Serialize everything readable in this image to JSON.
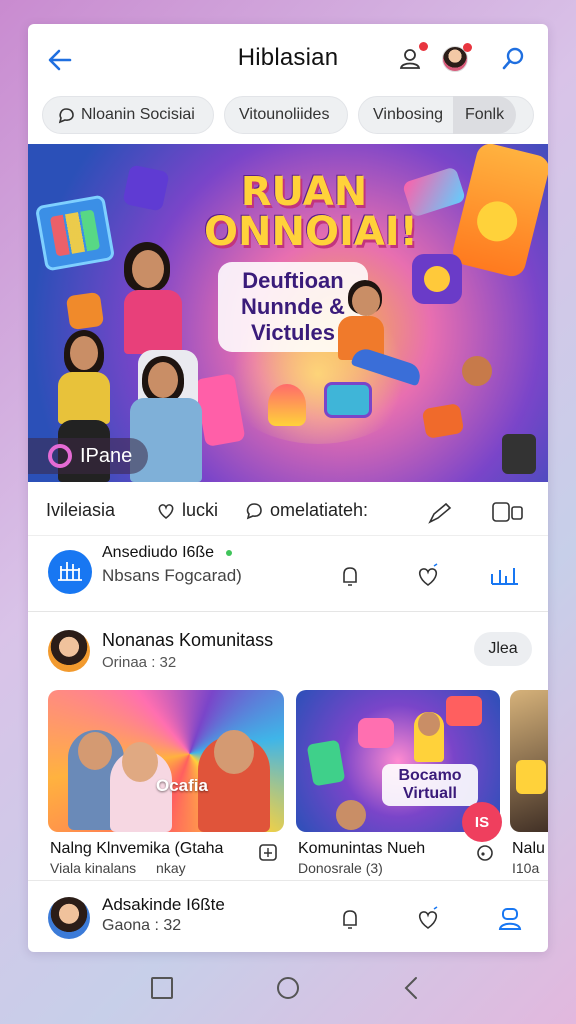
{
  "header": {
    "title": "Hiblasian",
    "back_icon": "arrow-left-icon",
    "icons": [
      "person-notification-icon",
      "profile-avatar",
      "link-icon"
    ]
  },
  "chips": [
    {
      "label": "Nloanin Socisiai",
      "icon": "chat-bubble-icon"
    },
    {
      "label": "Vitounoliides"
    },
    {
      "label": "Vinbosing",
      "segment": "Fonlk"
    }
  ],
  "banner": {
    "headline_1": "RUAN",
    "headline_2": "ONNOIAI!",
    "subtitle": "Deuftioan Nunnde & Victules",
    "live_label": "IPane"
  },
  "actions": {
    "label": "Ivileiasia",
    "like_label": "lucki",
    "comment_label": "omelatiateh:"
  },
  "post": {
    "name": "Ansediudo I6ße",
    "subtitle": "Nbsans Fogcarad)"
  },
  "group": {
    "name": "Nonanas Komunitass",
    "meta": "Orinaa : 32",
    "button": "Jlea"
  },
  "carousel": [
    {
      "title": "Nalng Klnvemika (Gtaha",
      "subtitle": "Viala kinalans",
      "extra": "nkay",
      "image_text": "Ocafia",
      "badge": ""
    },
    {
      "title": "Komunintas Nueh",
      "subtitle": "Donosrale (3)",
      "image_text": "Bocamo Virtuall",
      "badge": "IS"
    },
    {
      "title": "Nalu",
      "subtitle": "I10a"
    }
  ],
  "bottom_post": {
    "name": "Adsakinde I6ßte",
    "meta": "Gaona : 32"
  },
  "colors": {
    "accent": "#1877f2",
    "badge_red": "#ef3f5e",
    "notification_dot": "#e8353f"
  }
}
